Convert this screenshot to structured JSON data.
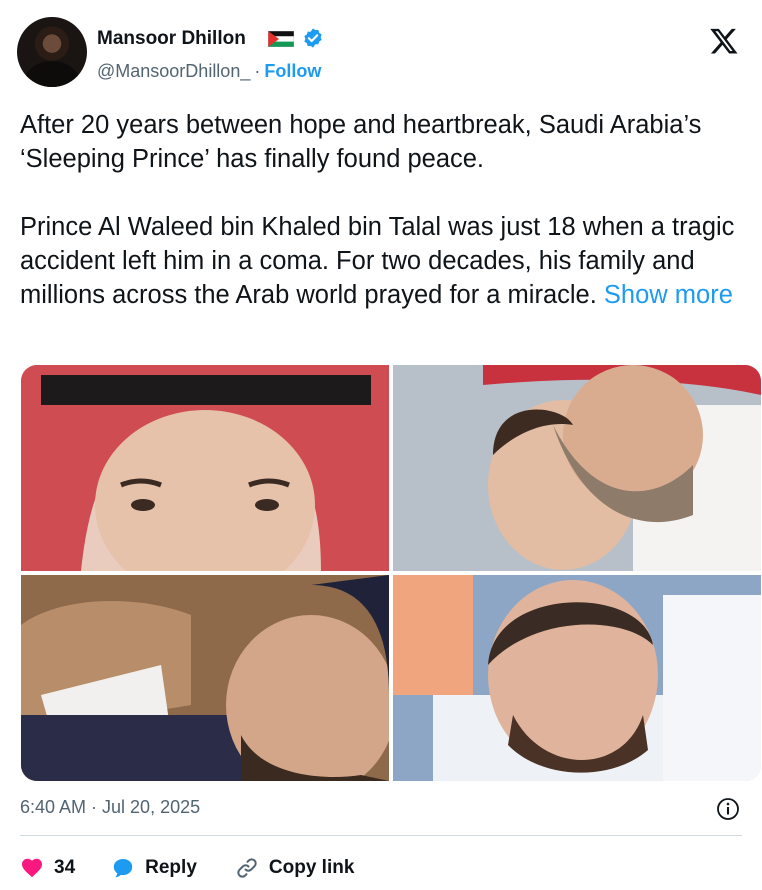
{
  "post": {
    "author": {
      "name": "Mansoor Dhillon",
      "handle": "@MansoorDhillon_",
      "separator": "·",
      "follow_label": "Follow",
      "flag_icon": "palestine-flag-icon",
      "verified_icon": "verified-badge-icon",
      "verified_color": "#1d9bf0"
    },
    "platform_icon": "x-logo-icon",
    "text": {
      "paragraph1": "After 20 years between hope and heartbreak, Saudi Arabia’s ‘Sleeping Prince’ has finally found peace.",
      "paragraph2": "Prince Al Waleed bin Khaled bin Talal was just 18 when a tragic accident left him in a coma. For two decades, his family and millions across the Arab world prayed for a miracle.",
      "show_more_label": "Show more"
    },
    "photos": [
      "photo-1",
      "photo-2",
      "photo-3",
      "photo-4"
    ],
    "timestamp": "6:40 AM · Jul 20, 2025",
    "actions": {
      "like_count": "34",
      "reply_label": "Reply",
      "copy_link_label": "Copy link"
    },
    "colors": {
      "accent": "#1d9bf0",
      "like": "#f91880",
      "muted": "#536471",
      "text": "#0f1419"
    }
  }
}
